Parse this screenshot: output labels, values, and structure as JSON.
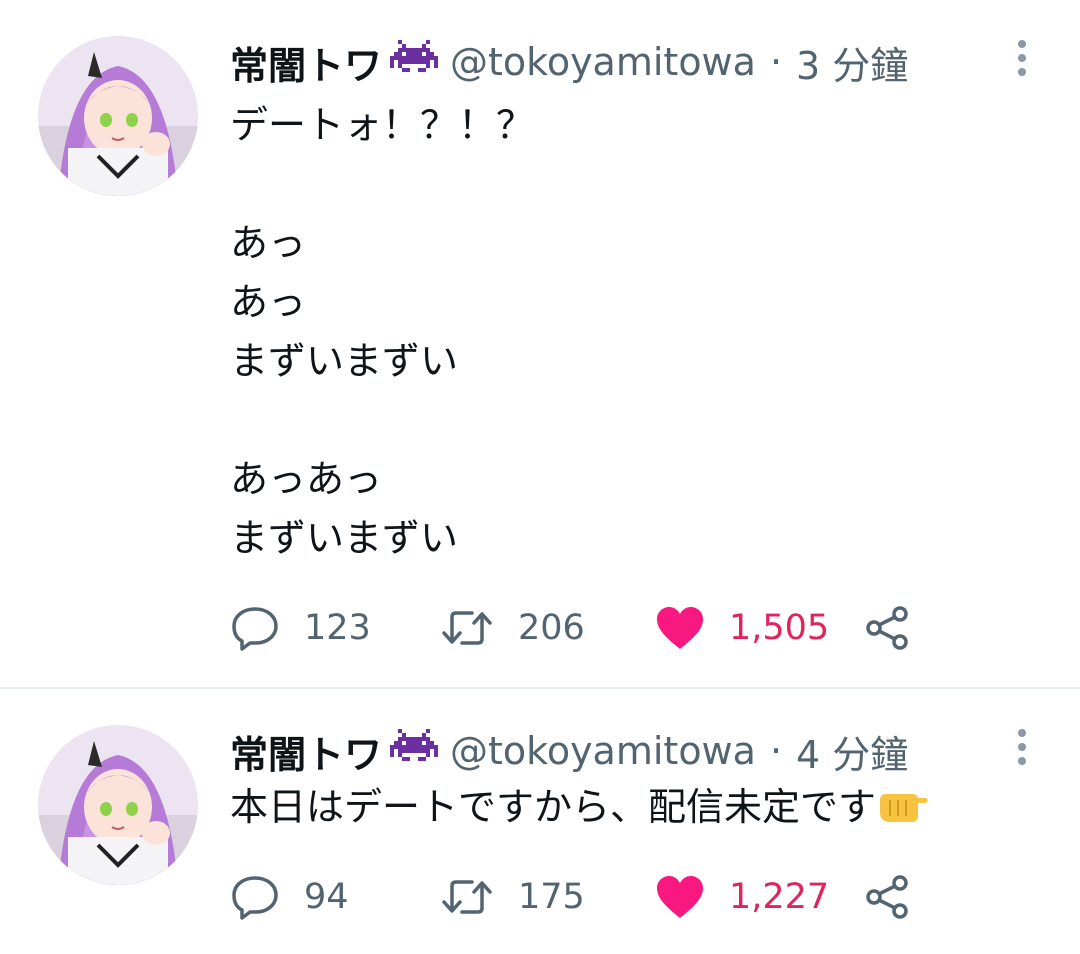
{
  "tweets": [
    {
      "display_name": "常闇トワ",
      "name_icon": "space-invader-icon",
      "handle": "@tokoyamitowa",
      "separator": "·",
      "time": "3 分鐘",
      "text_lines": [
        "デートォ！？！？",
        "",
        "あっ",
        "あっ",
        "まずいまずい",
        "",
        "あっあっ",
        "まずいまずい"
      ],
      "replies": "123",
      "retweets": "206",
      "likes": "1,505",
      "liked": true
    },
    {
      "display_name": "常闇トワ",
      "name_icon": "space-invader-icon",
      "handle": "@tokoyamitowa",
      "separator": "·",
      "time": "4 分鐘",
      "text_lines": [
        "本日はデートですから、配信未定です"
      ],
      "text_emoji": "fist-pointing-right-emoji",
      "replies": "94",
      "retweets": "175",
      "likes": "1,227",
      "liked": true
    }
  ],
  "colors": {
    "text": "#0f1419",
    "secondary": "#536471",
    "like": "#f91880",
    "invader": "#6b2fa0",
    "divider": "#e6ecf0"
  }
}
